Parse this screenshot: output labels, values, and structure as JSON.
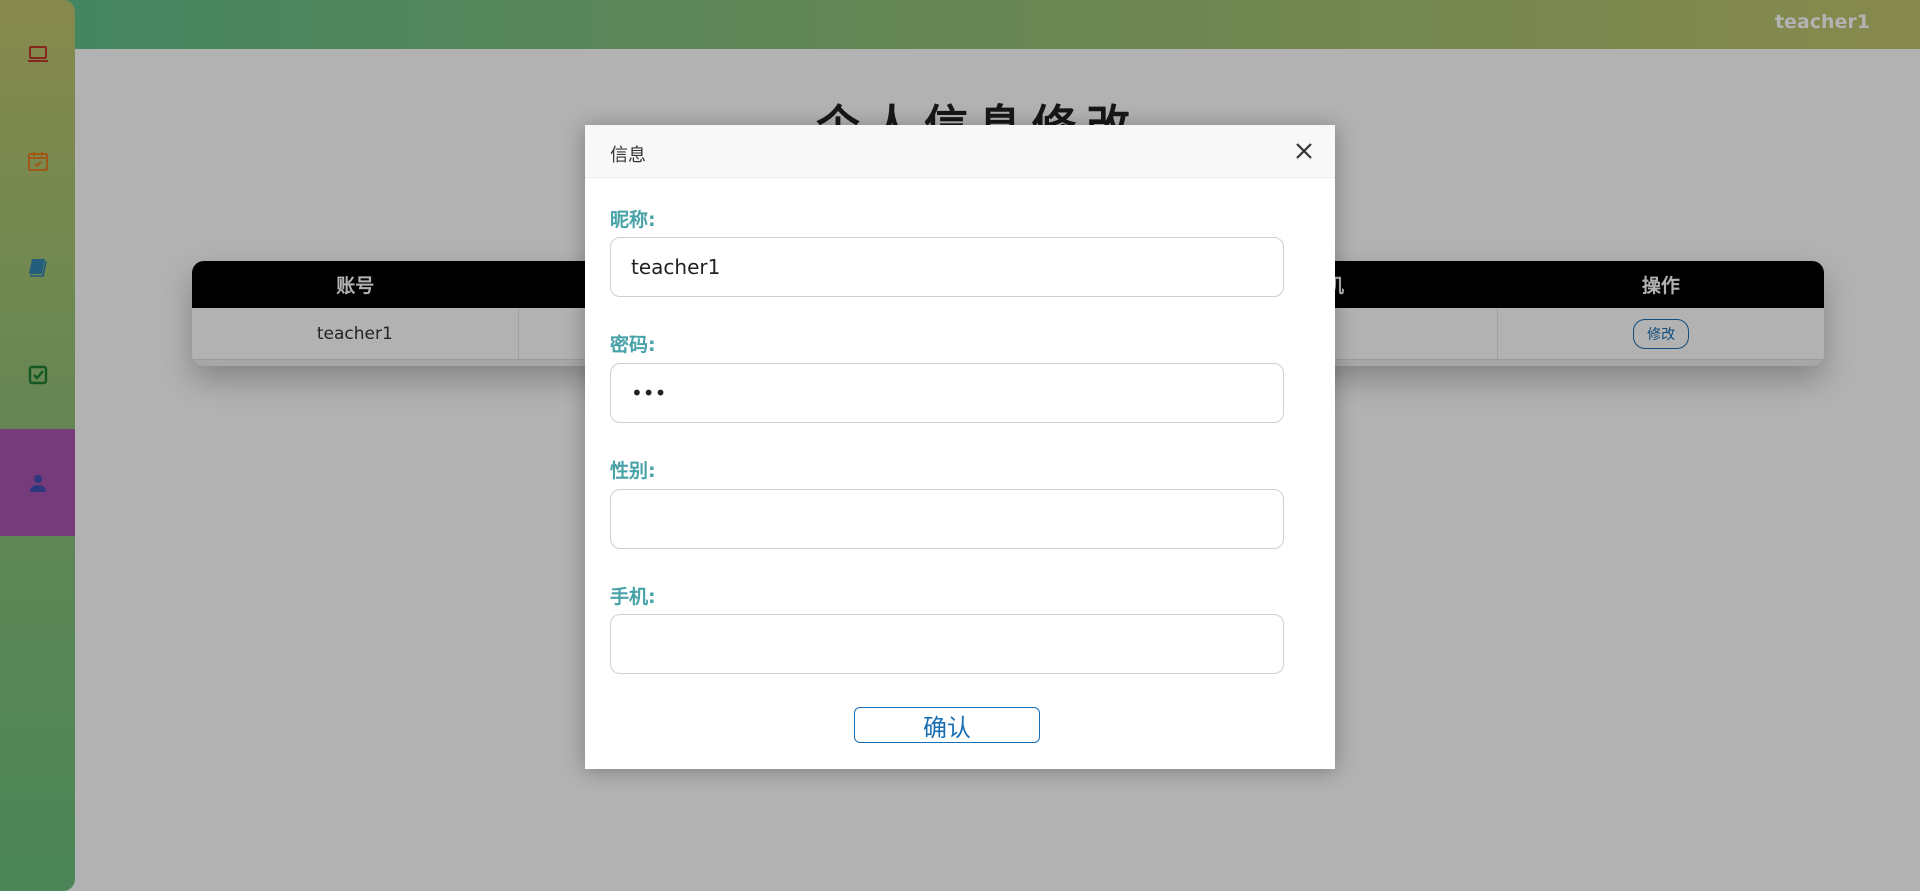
{
  "header": {
    "user_name": "teacher1"
  },
  "sidebar": {
    "items": [
      {
        "icon": "laptop-icon",
        "color": "#c0392b"
      },
      {
        "icon": "calendar-check-icon",
        "color": "#e67e22"
      },
      {
        "icon": "book-icon",
        "color": "#2980b9"
      },
      {
        "icon": "checkbox-icon",
        "color": "#1e7d32"
      },
      {
        "icon": "user-icon",
        "color": "#3f51b5",
        "active": true
      }
    ]
  },
  "page": {
    "title": "个人信息修改"
  },
  "table": {
    "columns": [
      "账号",
      "",
      "",
      "机",
      "操作"
    ],
    "row": {
      "account": "teacher1",
      "col2": "",
      "col3": "",
      "col4": "",
      "edit_label": "修改"
    }
  },
  "dialog": {
    "title": "信息",
    "fields": {
      "nickname": {
        "label": "昵称:",
        "value": "teacher1"
      },
      "password": {
        "label": "密码:",
        "value": "•••"
      },
      "gender": {
        "label": "性别:",
        "value": ""
      },
      "phone": {
        "label": "手机:",
        "value": ""
      }
    },
    "confirm_label": "确认"
  },
  "colors": {
    "accent": "#1a6fb4",
    "label": "#47a3a8",
    "sidebar_active": "#a855b0"
  }
}
